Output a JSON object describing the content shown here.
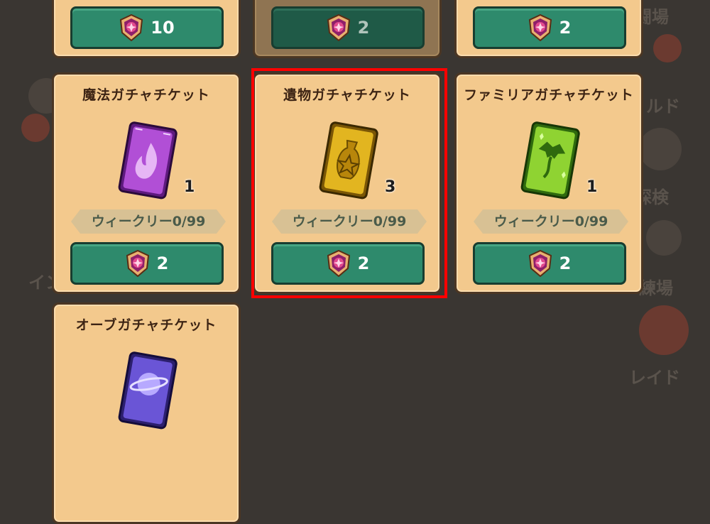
{
  "background_menu": {
    "right_labels": [
      "闘場",
      "ルド",
      "探検",
      "練場",
      "レイド"
    ],
    "left_labels": [
      "イン"
    ]
  },
  "top_row": [
    {
      "price": "10",
      "dimmed": false
    },
    {
      "price": "2",
      "dimmed": true
    },
    {
      "price": "2",
      "dimmed": false
    }
  ],
  "cards": [
    {
      "title": "魔法ガチャチケット",
      "quantity": "1",
      "weekly": "ウィークリー0/99",
      "price": "2",
      "ticket_icon": "fire-ticket-icon",
      "color": "#9b3bc0"
    },
    {
      "title": "遺物ガチャチケット",
      "quantity": "3",
      "weekly": "ウィークリー0/99",
      "price": "2",
      "ticket_icon": "relic-ticket-icon",
      "color": "#d6a010"
    },
    {
      "title": "ファミリアガチャチケット",
      "quantity": "1",
      "weekly": "ウィークリー0/99",
      "price": "2",
      "ticket_icon": "dragon-ticket-icon",
      "color": "#6fc028"
    },
    {
      "title": "オーブガチャチケット",
      "ticket_icon": "orb-ticket-icon",
      "color": "#5a46c8"
    }
  ],
  "highlight": {
    "target": "遺物ガチャチケット",
    "color": "#ff0000"
  }
}
